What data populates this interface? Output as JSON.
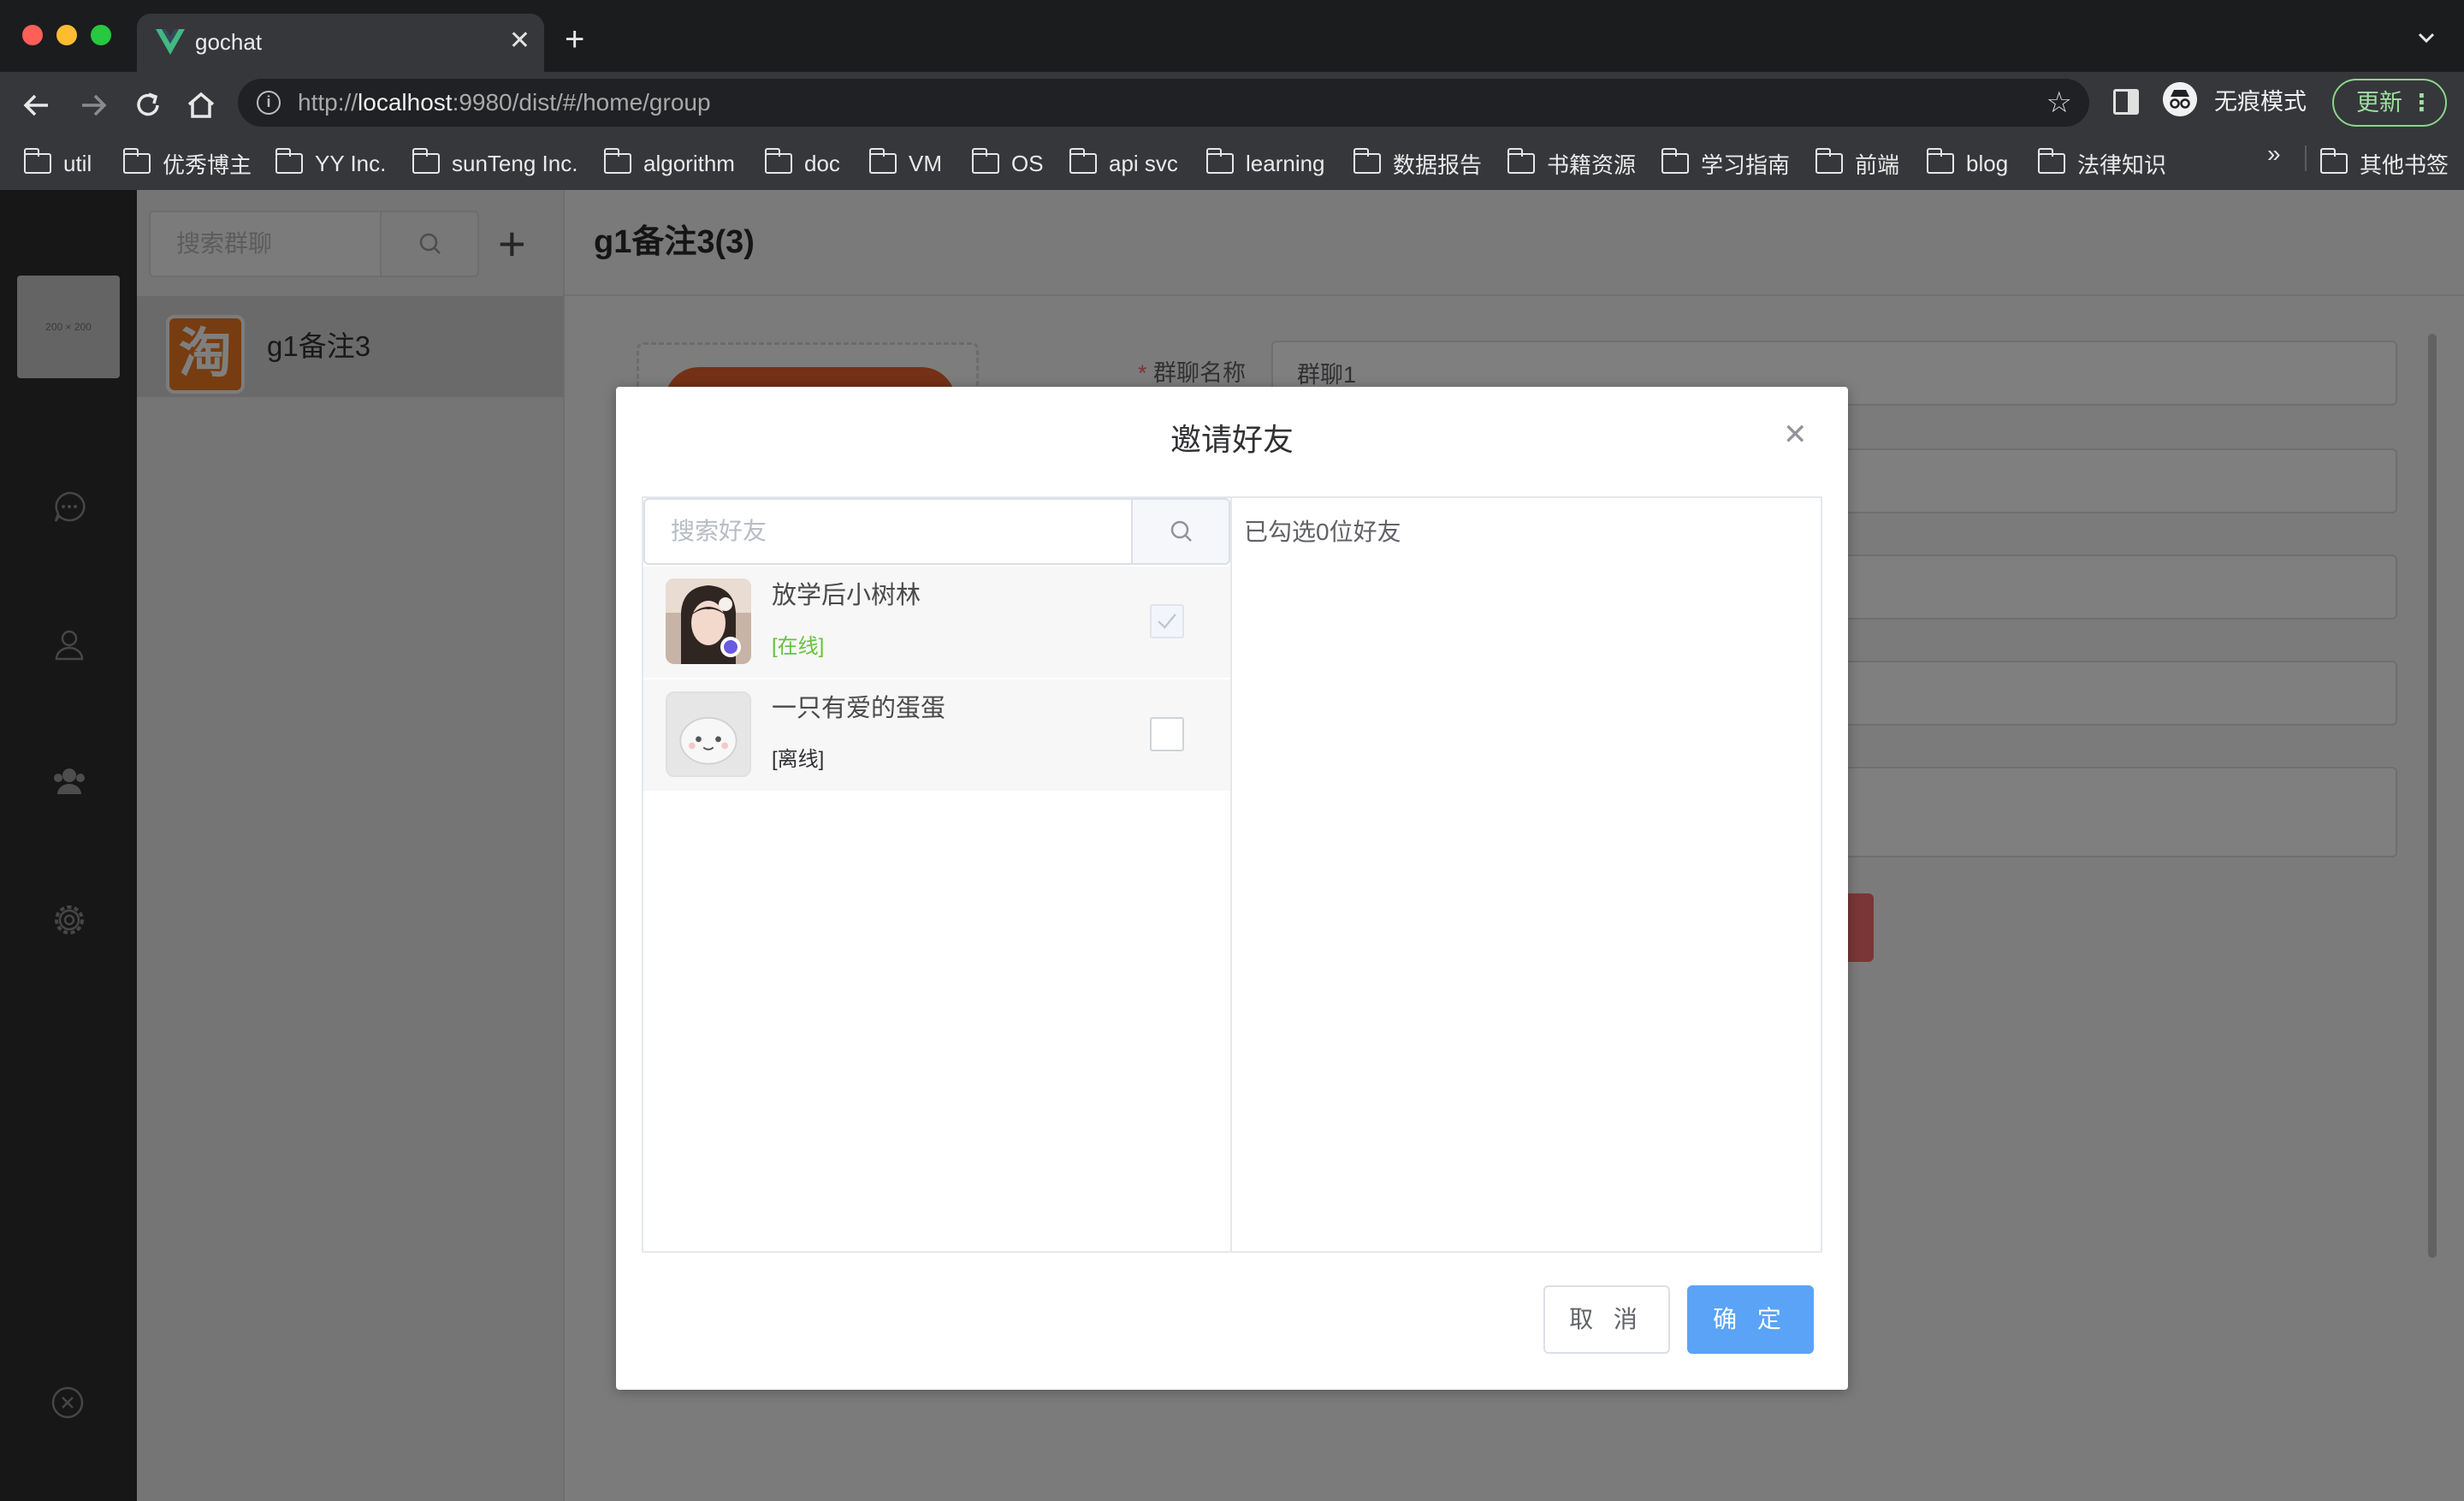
{
  "browser": {
    "tab_title": "gochat",
    "url_prefix": "http://",
    "url_host": "localhost",
    "url_rest": ":9980/dist/#/home/group",
    "incognito_label": "无痕模式",
    "update_label": "更新",
    "bookmarks": [
      "util",
      "优秀博主",
      "YY Inc.",
      "sunTeng Inc.",
      "algorithm",
      "doc",
      "VM",
      "OS",
      "api svc",
      "learning",
      "数据报告",
      "书籍资源",
      "学习指南",
      "前端",
      "blog",
      "法律知识"
    ],
    "bookmarks_more": "»",
    "other_bookmarks": "其他书签"
  },
  "app": {
    "avatar_placeholder": "200 × 200",
    "group_search_placeholder": "搜索群聊",
    "add_symbol": "+",
    "group_name": "g1备注3",
    "group_logo_char": "淘",
    "header_title": "g1备注3(3)",
    "form_label_name": "群聊名称",
    "form_value_name": "群聊1",
    "required_mark": "*"
  },
  "dialog": {
    "title": "邀请好友",
    "search_placeholder": "搜索好友",
    "selected_text": "已勾选0位好友",
    "cancel_label": "取 消",
    "confirm_label": "确 定",
    "friends": [
      {
        "name": "放学后小树林",
        "status": "[在线]",
        "status_color": "#67c23a",
        "checked": true
      },
      {
        "name": "一只有爱的蛋蛋",
        "status": "[离线]",
        "status_color": "#303133",
        "checked": false
      }
    ]
  },
  "colors": {
    "primary": "#5aa3f7",
    "online": "#67c23a",
    "danger": "#f56c6c",
    "brand_orange": "#ee7a22"
  }
}
